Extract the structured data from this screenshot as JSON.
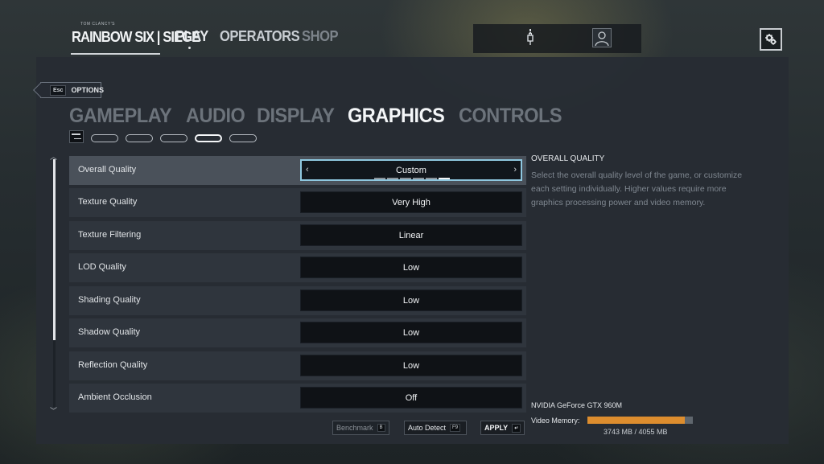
{
  "header": {
    "logo": {
      "small": "TOM CLANCY'S",
      "main": "RAINBOW SIX | SIEGE"
    },
    "nav": [
      {
        "label": "PLAY"
      },
      {
        "label": "OPERATORS"
      },
      {
        "label": "SHOP"
      }
    ],
    "icons": {
      "connection": "plug-icon",
      "profile": "avatar-icon",
      "settings": "gear-icon"
    }
  },
  "options": {
    "back": {
      "key": "Esc",
      "label": "OPTIONS"
    },
    "tabs": [
      {
        "label": "GAMEPLAY"
      },
      {
        "label": "AUDIO"
      },
      {
        "label": "DISPLAY"
      },
      {
        "label": "GRAPHICS"
      },
      {
        "label": "CONTROLS"
      }
    ],
    "active_tab": "GRAPHICS",
    "tab_page_count": 5,
    "active_page": 4
  },
  "settings": [
    {
      "label": "Overall Quality",
      "value": "Custom"
    },
    {
      "label": "Texture Quality",
      "value": "Very High"
    },
    {
      "label": "Texture Filtering",
      "value": "Linear"
    },
    {
      "label": "LOD Quality",
      "value": "Low"
    },
    {
      "label": "Shading Quality",
      "value": "Low"
    },
    {
      "label": "Shadow Quality",
      "value": "Low"
    },
    {
      "label": "Reflection Quality",
      "value": "Low"
    },
    {
      "label": "Ambient Occlusion",
      "value": "Off"
    }
  ],
  "overall_quality_segments": {
    "total": 6,
    "selected": 6
  },
  "description": {
    "title": "OVERALL QUALITY",
    "text": "Select the overall quality level of the game, or customize each setting individually. Higher values require more graphics processing power and video memory."
  },
  "footer": {
    "benchmark": {
      "label": "Benchmark",
      "key": "B"
    },
    "auto_detect": {
      "label": "Auto Detect",
      "key": "F9"
    },
    "apply": {
      "label": "APPLY",
      "key": "↵"
    }
  },
  "gpu": {
    "name": "NVIDIA GeForce GTX 960M",
    "vram_label": "Video Memory:",
    "vram_used_mb": 3743,
    "vram_total_mb": 4055,
    "vram_text": "3743 MB / 4055 MB",
    "vram_bar_color": "#dd8d2e"
  }
}
